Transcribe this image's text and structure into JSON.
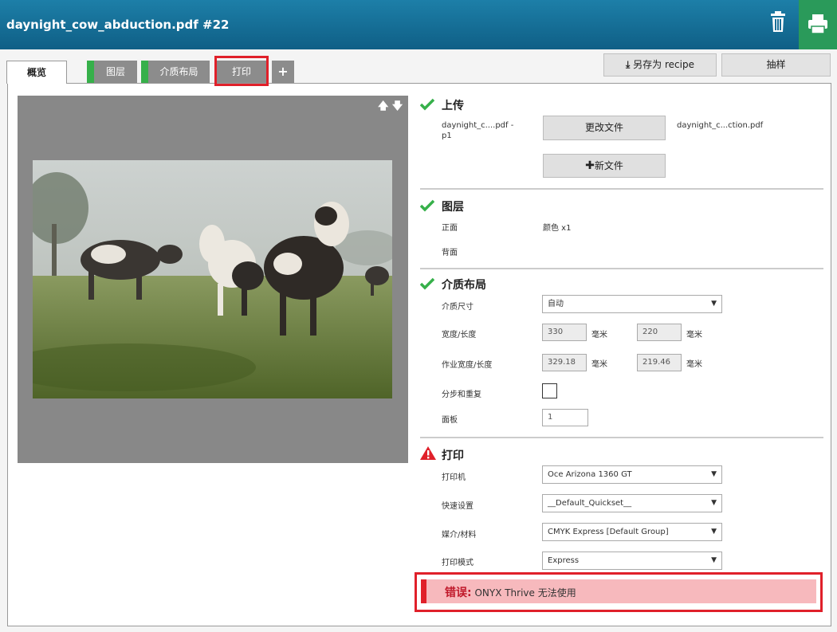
{
  "header": {
    "title": "daynight_cow_abduction.pdf #22"
  },
  "tabs": [
    {
      "label": "概览"
    },
    {
      "label": "图层"
    },
    {
      "label": "介质布局"
    },
    {
      "label": "打印"
    },
    {
      "label": "+"
    }
  ],
  "actions": {
    "save_recipe": "另存为 recipe",
    "sample": "抽样"
  },
  "upload": {
    "title": "上传",
    "file_label_line1": "daynight_c....pdf -",
    "file_label_line2": "p1",
    "change_file": "更改文件",
    "new_file": "新文件",
    "current_file": "daynight_c...ction.pdf"
  },
  "layers": {
    "title": "图层",
    "front_label": "正面",
    "front_value": "颜色 x1",
    "back_label": "背面"
  },
  "media_layout": {
    "title": "介质布局",
    "media_size_label": "介质尺寸",
    "media_size_value": "自动",
    "width_length_label": "宽度/长度",
    "width": "330",
    "length": "220",
    "unit": "毫米",
    "job_width_length_label": "作业宽度/长度",
    "job_width": "329.18",
    "job_length": "219.46",
    "step_repeat_label": "分步和重复",
    "panels_label": "面板",
    "panels_value": "1"
  },
  "print": {
    "title": "打印",
    "printer_label": "打印机",
    "printer_value": "Oce Arizona 1360 GT",
    "quickset_label": "快速设置",
    "quickset_value": "__Default_Quickset__",
    "media_label": "媒介/材料",
    "media_value": "CMYK Express [Default Group]",
    "mode_label": "打印模式",
    "mode_value": "Express"
  },
  "error": {
    "prefix": "错误:",
    "message": "ONYX Thrive 无法使用"
  },
  "colors": {
    "header": "#0f5f86",
    "ok": "#36b04a",
    "error": "#e0202a",
    "print_button": "#2a9a5a"
  }
}
